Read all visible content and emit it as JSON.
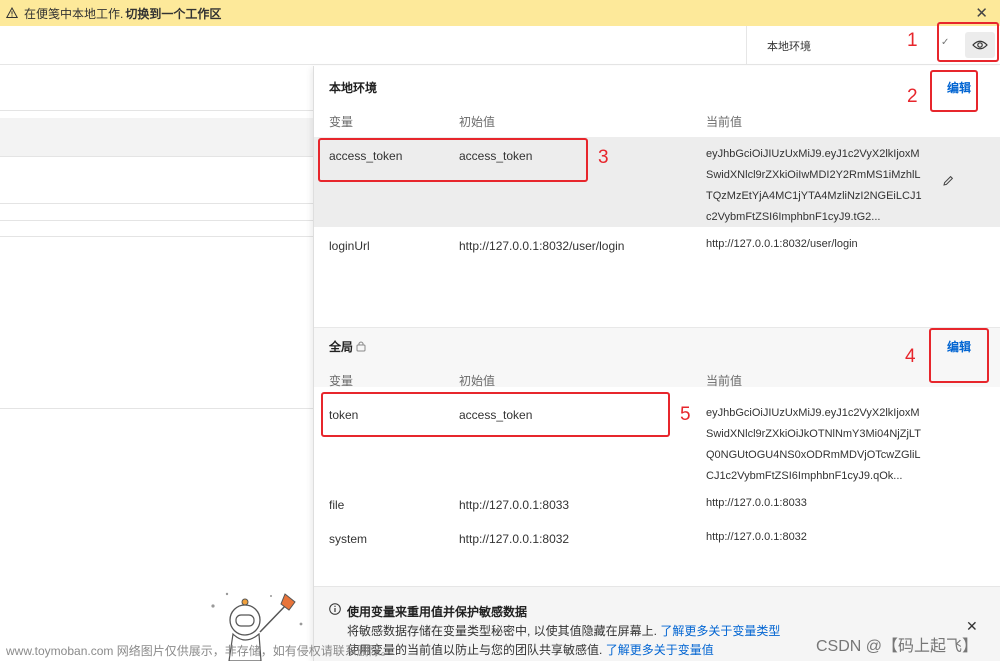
{
  "banner": {
    "text": "在便笺中本地工作.",
    "link": "切换到一个工作区"
  },
  "env_selector": {
    "label": "本地环境"
  },
  "local_env": {
    "title": "本地环境",
    "edit_label": "编辑",
    "columns": [
      "变量",
      "初始值",
      "当前值"
    ],
    "rows": [
      {
        "variable": "access_token",
        "initial": "access_token",
        "current_lines": [
          "eyJhbGciOiJIUzUxMiJ9.eyJ1c2VyX2lkIjoxM",
          "SwidXNlcl9rZXkiOiIwMDI2Y2RmMS1iMzhlL",
          "TQzMzEtYjA4MC1jYTA4MzliNzI2NGEiLCJ1",
          "c2VybmFtZSI6ImphbnF1cyJ9.tG2..."
        ]
      },
      {
        "variable": "loginUrl",
        "initial": "http://127.0.0.1:8032/user/login",
        "current_lines": [
          "http://127.0.0.1:8032/user/login"
        ]
      }
    ]
  },
  "global_env": {
    "title": "全局",
    "edit_label": "编辑",
    "columns": [
      "变量",
      "初始值",
      "当前值"
    ],
    "rows": [
      {
        "variable": "token",
        "initial": "access_token",
        "current_lines": [
          "eyJhbGciOiJIUzUxMiJ9.eyJ1c2VyX2lkIjoxM",
          "SwidXNlcl9rZXkiOiJkOTNlNmY3Mi04NjZjLT",
          "Q0NGUtOGU4NS0xODRmMDVjOTcwZGliL",
          "CJ1c2VybmFtZSI6ImphbnF1cyJ9.qOk..."
        ]
      },
      {
        "variable": "file",
        "initial": "http://127.0.0.1:8033",
        "current_lines": [
          "http://127.0.0.1:8033"
        ]
      },
      {
        "variable": "system",
        "initial": "http://127.0.0.1:8032",
        "current_lines": [
          "http://127.0.0.1:8032"
        ]
      }
    ]
  },
  "notice": {
    "title": "使用变量来重用值并保护敏感数据",
    "line1": "将敏感数据存储在变量类型秘密中, 以使其值隐藏在屏幕上.",
    "line1_link": "了解更多关于变量类型",
    "line2": "使用变量的当前值以防止与您的团队共享敏感值.",
    "line2_link": "了解更多关于变量值"
  },
  "annotations": [
    "1",
    "2",
    "3",
    "4",
    "5"
  ],
  "watermarks": {
    "left": "www.toymoban.com 网络图片仅供展示，非存储，如有侵权请联系删除。",
    "right": "CSDN @【码上起飞】"
  },
  "colors": {
    "banner_bg": "#fde99a",
    "link_blue": "#0265d2",
    "annotation_red": "#e7262c"
  },
  "icons": [
    "warning-icon",
    "close-icon",
    "chevron-down-icon",
    "eye-icon",
    "pencil-icon",
    "lock-icon",
    "info-icon",
    "astronaut-illustration"
  ]
}
